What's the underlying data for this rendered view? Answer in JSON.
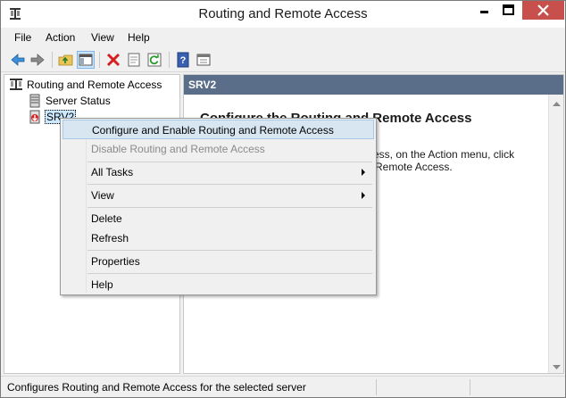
{
  "window": {
    "title": "Routing and Remote Access",
    "controls": {
      "minimize": "minimize",
      "maximize": "maximize",
      "close": "close"
    }
  },
  "menubar": {
    "items": [
      "File",
      "Action",
      "View",
      "Help"
    ]
  },
  "toolbar": {
    "buttons": [
      "back-icon",
      "forward-icon",
      "up-folder-icon",
      "show-hide-tree-icon",
      "delete-icon",
      "properties-icon",
      "refresh-icon",
      "help-icon",
      "console-view-icon"
    ]
  },
  "tree": {
    "root": "Routing and Remote Access",
    "children": [
      {
        "label": "Server Status",
        "icon": "server-status-icon"
      },
      {
        "label": "SRV2",
        "icon": "server-down-icon",
        "selected": true
      }
    ]
  },
  "right_pane": {
    "header": "SRV2",
    "heading": "Configure the Routing and Remote Access",
    "text_line1": "ess, on the Action menu, click",
    "text_line2": "Remote Access."
  },
  "context_menu": {
    "items": [
      {
        "label": "Configure and Enable Routing and Remote Access",
        "enabled": true
      },
      {
        "label": "Disable Routing and Remote Access",
        "enabled": false
      },
      {
        "label": "All Tasks",
        "submenu": true
      },
      {
        "label": "View",
        "submenu": true
      },
      {
        "label": "Delete",
        "enabled": true
      },
      {
        "label": "Refresh",
        "enabled": true
      },
      {
        "label": "Properties",
        "enabled": true
      },
      {
        "label": "Help",
        "enabled": true
      }
    ]
  },
  "statusbar": {
    "text": "Configures Routing and Remote Access for the selected server"
  },
  "colors": {
    "pane_header": "#5a6e8a",
    "close_button": "#c7504c",
    "highlight": "#d8e6f2"
  }
}
